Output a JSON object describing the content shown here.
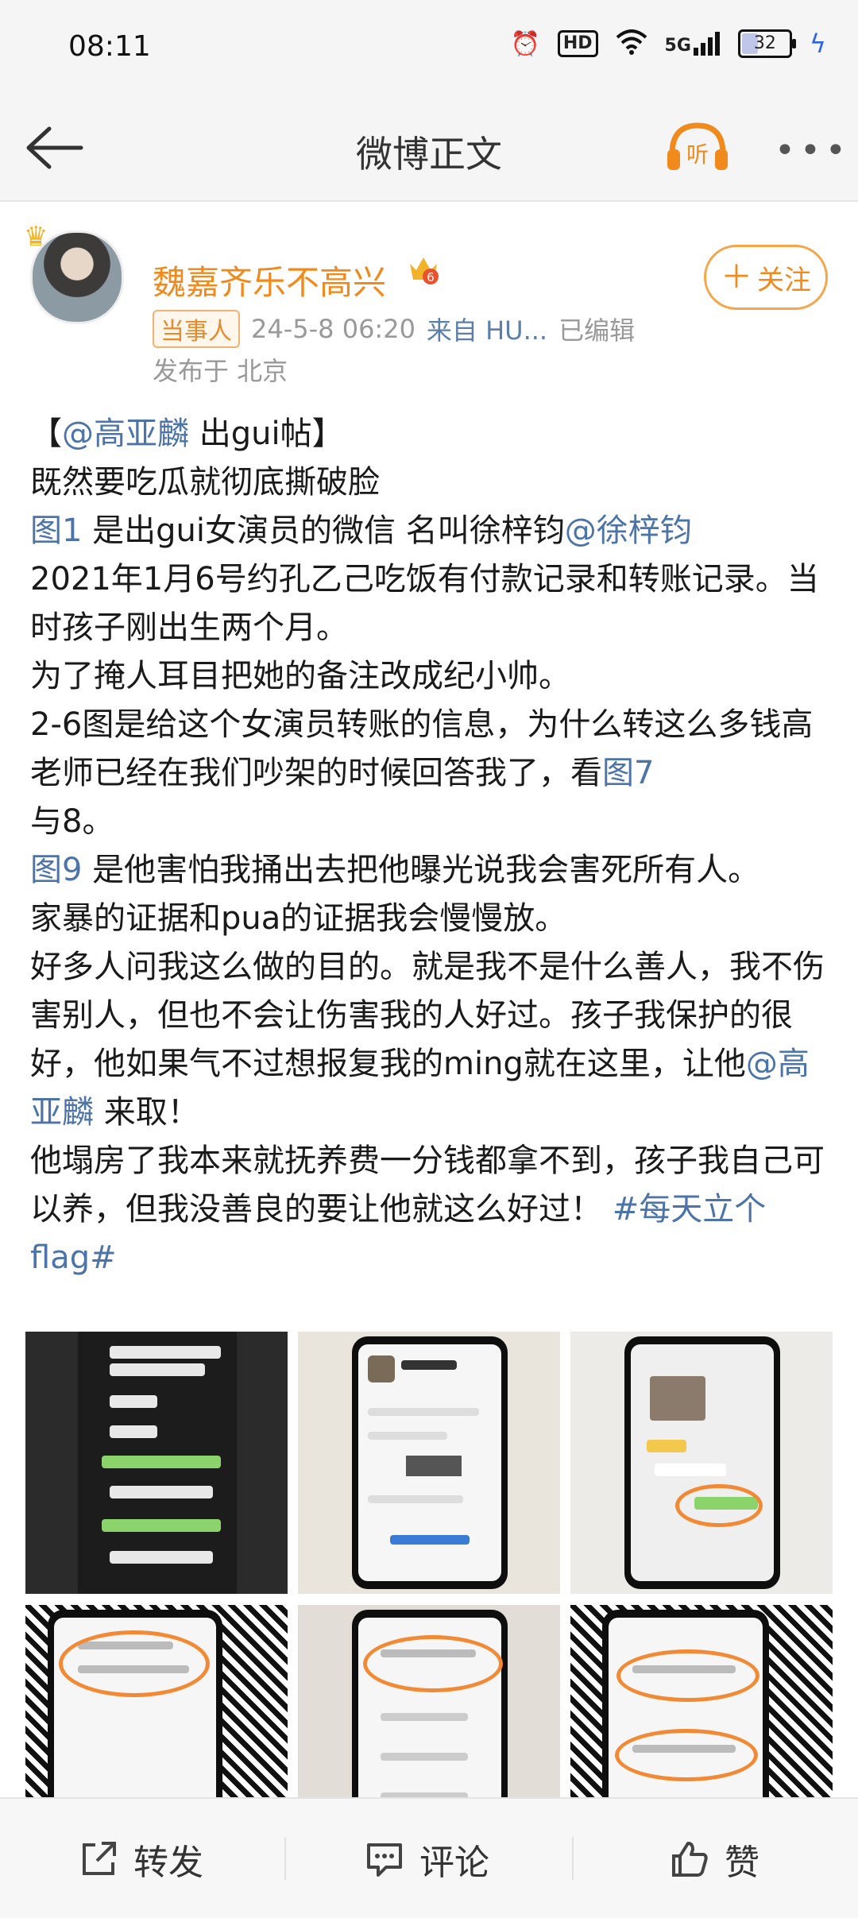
{
  "status_bar": {
    "time": "08:11",
    "hd_label": "HD",
    "signal_label": "5G",
    "battery_level": "32"
  },
  "nav": {
    "title": "微博正文",
    "listen_label": "听"
  },
  "author": {
    "name": "魏嘉齐乐不高兴",
    "vip_badge": "6",
    "role_tag": "当事人",
    "date": "24-5-8 06:20",
    "source": "来自 HU...",
    "edited": "已编辑",
    "location": "发布于 北京",
    "follow_label": "关注"
  },
  "post": {
    "p1": "【",
    "mention1": "@高亚麟",
    "p1b": " 出gui帖】\n既然要吃瓜就彻底撕破脸\n",
    "img1": "图1",
    "p2": " 是出gui女演员的微信 名叫徐梓钧",
    "mention2": "@徐梓钧",
    "p3": "\n2021年1月6号约孔乙己吃饭有付款记录和转账记录。当时孩子刚出生两个月。\n为了掩人耳目把她的备注改成纪小帅。\n2-6图是给这个女演员转账的信息，为什么转这么多钱高老师已经在我们吵架的时候回答我了，看",
    "img7": "图7",
    "p4": "\n与8。\n",
    "img9": "图9",
    "p5": " 是他害怕我捅出去把他曝光说我会害死所有人。\n家暴的证据和pua的证据我会慢慢放。\n好多人问我这么做的目的。就是我不是什么善人，我不伤害别人，但也不会让伤害我的人好过。孩子我保护的很好，他如果气不过想报复我的ming就在这里，让他",
    "mention3": "@高亚麟",
    "p6": " 来取！\n他塌房了我本来就抚养费一分钱都拿不到，孩子我自己可以养，但我没善良的要让他就这么好过！ ",
    "topic": "#每天立个flag#"
  },
  "bottom_bar": {
    "repost": "转发",
    "comment": "评论",
    "like": "赞"
  },
  "colors": {
    "accent_orange": "#f08a1c",
    "link_blue": "#4c74a8",
    "highlight_ring": "#f28a35"
  }
}
